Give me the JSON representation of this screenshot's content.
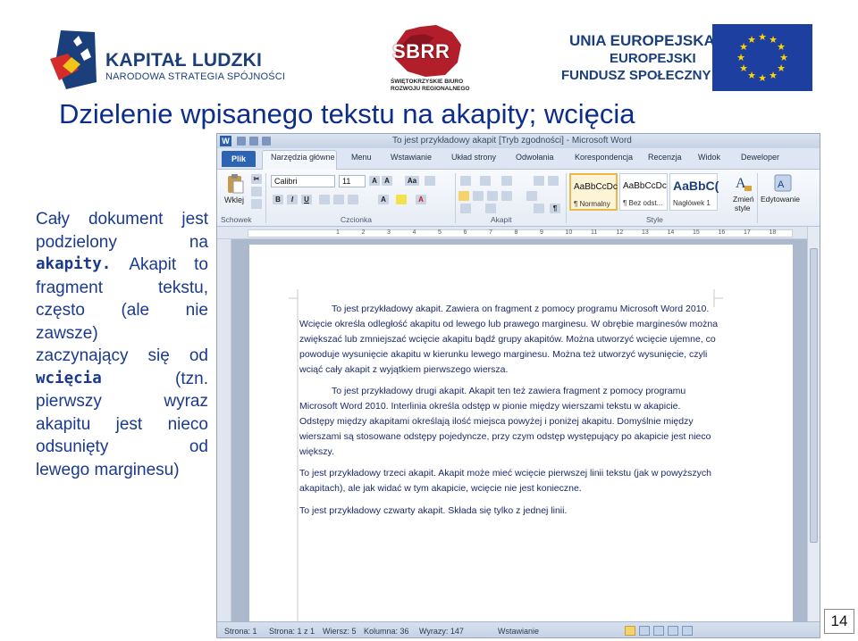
{
  "header": {
    "kl_line1": "KAPITAŁ LUDZKI",
    "kl_line2": "NARODOWA STRATEGIA SPÓJNOŚCI",
    "sbrr": "SBRR",
    "sbrr_line1": "ŚWIĘTOKRZYSKIE BIURO",
    "sbrr_line2": "ROZWOJU REGIONALNEGO",
    "ue_line1": "UNIA EUROPEJSKA",
    "ue_line2": "EUROPEJSKI",
    "ue_line3": "FUNDUSZ SPOŁECZNY"
  },
  "slide": {
    "title": "Dzielenie wpisanego tekstu na akapity; wcięcia",
    "page_number": "14",
    "body": {
      "l1a": "Cały",
      "l1b": "dokument",
      "l1c": "jest",
      "l2a": "podzielony",
      "l2b": "na",
      "l3a": "akapity.",
      "l3b": "Akapit",
      "l3c": "to",
      "l4a": "fragment",
      "l4b": "tekstu,",
      "l5a": "często",
      "l5b": "(ale",
      "l5c": "nie",
      "l6": "zawsze)",
      "l7a": "zaczynający",
      "l7b": "się",
      "l7c": "od",
      "l8a": "wcięcia",
      "l8b": "(tzn.",
      "l9a": "pierwszy",
      "l9b": "wyraz",
      "l10a": "akapitu",
      "l10b": "jest",
      "l10c": "nieco",
      "l11a": "odsunięty",
      "l11b": "od",
      "l12": "lewego marginesu)"
    }
  },
  "word": {
    "window_title": "To jest przykładowy akapit [Tryb zgodności] - Microsoft Word",
    "tabs": [
      "Plik",
      "Narzędzia główne",
      "Menu",
      "Wstawianie",
      "Układ strony",
      "Odwołania",
      "Korespondencja",
      "Recenzja",
      "Widok",
      "Deweloper"
    ],
    "ribbon": {
      "paste": "Wklej",
      "clipboard": "Schowek",
      "font_name": "Calibri",
      "font_size": "11",
      "font_group": "Czcionka",
      "paragraph_group": "Akapit",
      "styles_group": "Style",
      "style1_preview": "AaBbCcDc",
      "style1_name": "¶ Normalny",
      "style2_preview": "AaBbCcDc",
      "style2_name": "¶ Bez odst...",
      "style3_preview": "AaBbC(",
      "style3_name": "Nagłówek 1",
      "change_styles_1": "Zmień",
      "change_styles_2": "style",
      "editing": "Edytowanie"
    },
    "ruler_numbers": [
      "1",
      "2",
      "3",
      "4",
      "5",
      "6",
      "7",
      "8",
      "9",
      "10",
      "11",
      "12",
      "13",
      "14",
      "15",
      "16",
      "17",
      "18"
    ],
    "document": {
      "p1": [
        "To jest przykładowy akapit. Zawiera on fragment z pomocy programu Microsoft Word 2010.",
        "Wcięcie określa odległość akapitu od lewego lub prawego marginesu. W obrębie marginesów można",
        "zwiększać lub zmniejszać wcięcie akapitu bądź grupy akapitów. Można utworzyć wcięcie ujemne, co",
        "powoduje wysunięcie akapitu w kierunku lewego marginesu. Można też utworzyć wysunięcie, czyli",
        "wciąć cały akapit z wyjątkiem pierwszego wiersza."
      ],
      "p2": [
        "To jest przykładowy drugi akapit. Akapit ten też zawiera fragment z pomocy programu",
        "Microsoft Word 2010.  Interlinia określa odstęp w pionie między wierszami tekstu w akapicie.",
        "Odstępy między akapitami określają ilość miejsca powyżej i poniżej akapitu. Domyślnie między",
        "wierszami są stosowane odstępy pojedyncze, przy czym odstęp występujący po akapicie jest nieco",
        "większy."
      ],
      "p3": [
        "To jest przykładowy trzeci akapit. Akapit może mieć wcięcie pierwszej linii tekstu (jak w powyższych",
        "akapitach), ale jak widać w tym akapicie, wcięcie nie jest konieczne."
      ],
      "p4": [
        "To jest przykładowy czwarty akapit. Składa się tylko z jednej linii."
      ]
    },
    "status": {
      "page": "Strona: 1",
      "pages": "Strona: 1 z 1",
      "line": "Wiersz: 5",
      "column": "Kolumna: 36",
      "words": "Wyrazy: 147",
      "mode": "Wstawianie"
    }
  }
}
